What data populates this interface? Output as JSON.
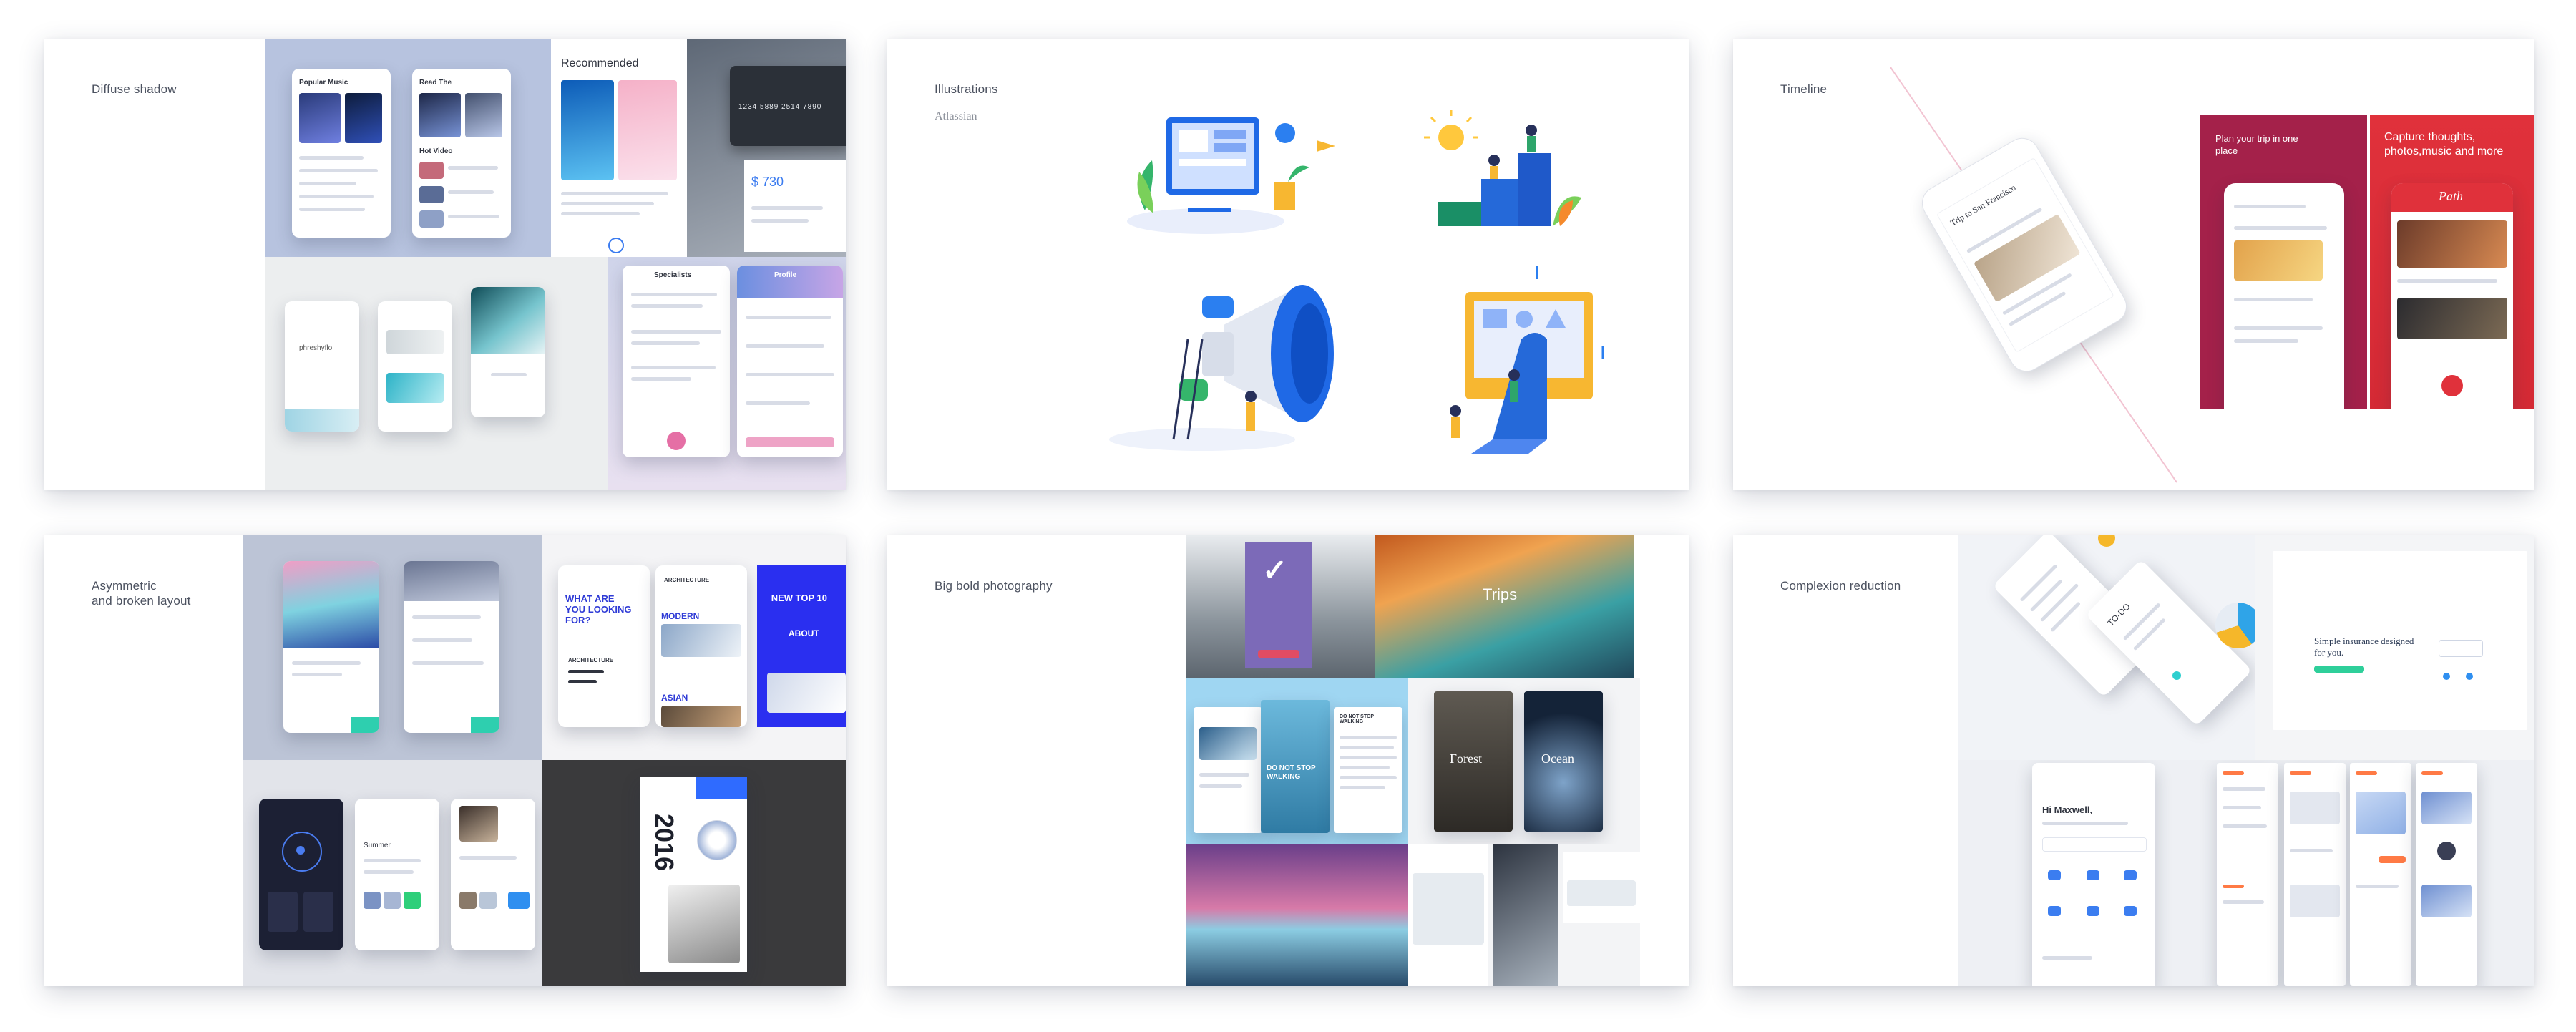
{
  "cards": [
    {
      "title": "Diffuse shadow",
      "shots": {
        "popular_music": "Popular Music",
        "read_the": "Read The",
        "hot_video": "Hot Video",
        "recommended": "Recommended",
        "card_number": "1234 5889 2514 7890",
        "price": "$ 730",
        "brand": "phreshyflo",
        "specialists": "Specialists",
        "profile": "Profile"
      }
    },
    {
      "title": "Illustrations",
      "subtitle": "Atlassian"
    },
    {
      "title": "Timeline",
      "shots": {
        "trip": "Trip to San Francisco",
        "plan": "Plan your trip in one place",
        "capture": "Capture thoughts, photos,music and more",
        "path_logo": "Path"
      }
    },
    {
      "title": "Asymmetric\nand broken layout",
      "shots": {
        "looking_for": "WHAT ARE YOU LOOKING FOR?",
        "architecture": "ARCHITECTURE",
        "modern": "MODERN",
        "asian": "ASIAN",
        "new_top": "NEW TOP 10",
        "about": "ABOUT",
        "year": "2016",
        "summer": "Summer"
      }
    },
    {
      "title": "Big bold photography",
      "shots": {
        "trips": "Trips",
        "forest": "Forest",
        "ocean": "Ocean",
        "never_stop": "DO NOT STOP WALKING"
      }
    },
    {
      "title": "Complexion reduction",
      "shots": {
        "todo": "TO-DO",
        "insurance": "Simple insurance designed for you.",
        "greeting": "Hi Maxwell,"
      }
    }
  ],
  "colors": {
    "accent_blue": "#2f6bff",
    "path_red": "#e0313b",
    "timeline_magenta": "#a4214a",
    "teal": "#2ecfaf"
  }
}
